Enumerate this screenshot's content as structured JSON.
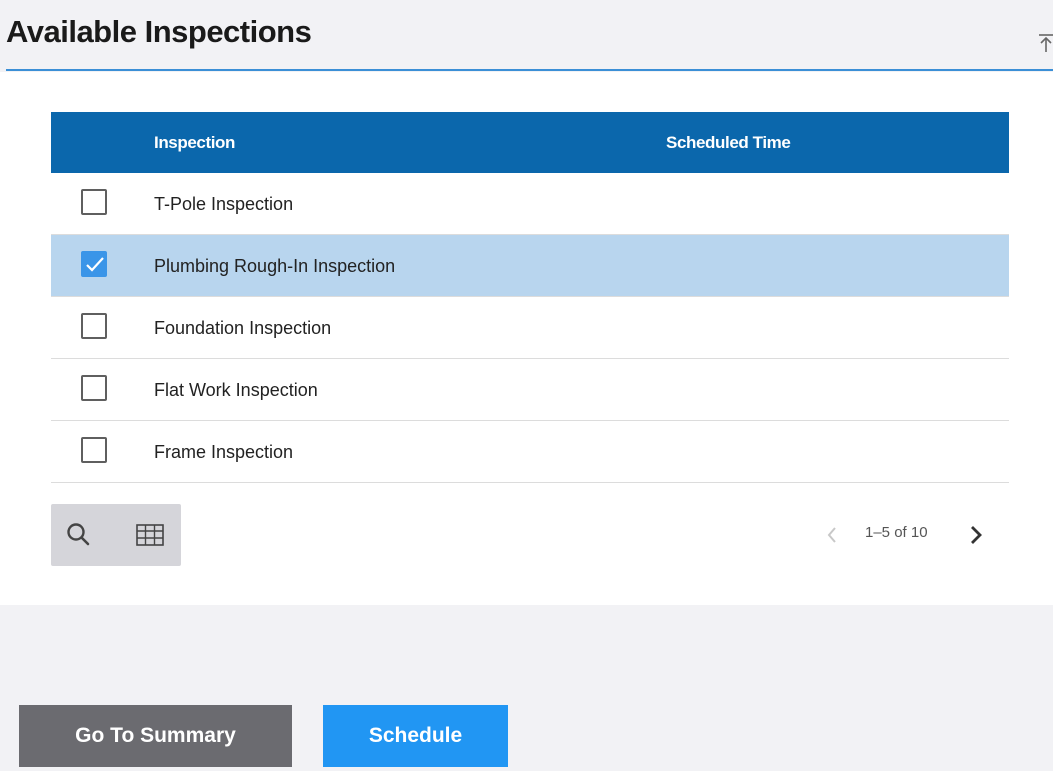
{
  "header": {
    "title": "Available Inspections"
  },
  "table": {
    "columns": [
      "Inspection",
      "Scheduled Time"
    ],
    "rows": [
      {
        "label": "T-Pole Inspection",
        "checked": false,
        "scheduled_time": ""
      },
      {
        "label": "Plumbing Rough-In Inspection",
        "checked": true,
        "scheduled_time": ""
      },
      {
        "label": "Foundation Inspection",
        "checked": false,
        "scheduled_time": ""
      },
      {
        "label": "Flat Work Inspection",
        "checked": false,
        "scheduled_time": ""
      },
      {
        "label": "Frame Inspection",
        "checked": false,
        "scheduled_time": ""
      }
    ]
  },
  "toolbar": {
    "search_icon": "search-icon",
    "columns_icon": "table-columns-icon"
  },
  "pagination": {
    "range_text": "1–5 of 10",
    "prev_icon": "chevron-left-icon",
    "next_icon": "chevron-right-icon"
  },
  "footer": {
    "summary_label": "Go To Summary",
    "schedule_label": "Schedule"
  },
  "colors": {
    "accent": "#0b67ac",
    "selected_row": "#b8d5ee",
    "checkbox_checked": "#3a95e8",
    "primary_button": "#2196f3",
    "secondary_button": "#6b6b70"
  }
}
